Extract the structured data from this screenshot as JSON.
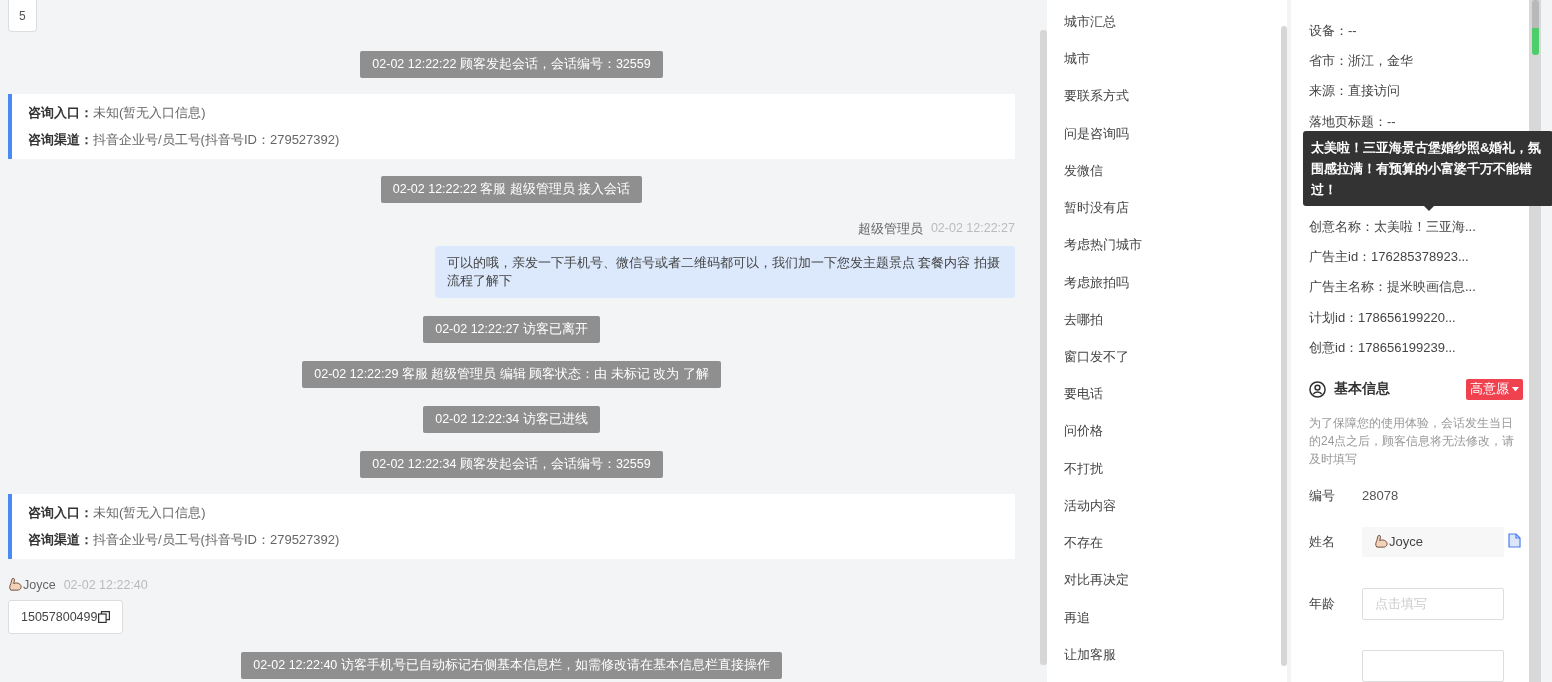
{
  "top_badge": "5",
  "chat": [
    {
      "kind": "notice",
      "text": "02-02 12:22:22 顾客发起会话，会话编号：32559"
    },
    {
      "kind": "source",
      "entry_label": "咨询入口：",
      "entry_value": "未知(暂无入口信息)",
      "channel_label": "咨询渠道：",
      "channel_value": "抖音企业号/员工号(抖音号ID：279527392)"
    },
    {
      "kind": "notice",
      "text": "02-02 12:22:22 客服 超级管理员 接入会话"
    },
    {
      "kind": "agent",
      "sender": "超级管理员",
      "time": "02-02 12:22:27",
      "text": "可以的哦，亲发一下手机号、微信号或者二维码都可以，我们加一下您发主题景点 套餐内容 拍摄流程了解下"
    },
    {
      "kind": "notice",
      "text": "02-02 12:22:27 访客已离开"
    },
    {
      "kind": "notice",
      "text": "02-02 12:22:29 客服 超级管理员 编辑 顾客状态：由 未标记 改为 了解"
    },
    {
      "kind": "notice",
      "text": "02-02 12:22:34 访客已进线"
    },
    {
      "kind": "notice",
      "text": "02-02 12:22:34 顾客发起会话，会话编号：32559"
    },
    {
      "kind": "source",
      "entry_label": "咨询入口：",
      "entry_value": "未知(暂无入口信息)",
      "channel_label": "咨询渠道：",
      "channel_value": "抖音企业号/员工号(抖音号ID：279527392)"
    },
    {
      "kind": "visitor",
      "sender": "Joyce",
      "time": "02-02 12:22:40",
      "text": "15057800499"
    },
    {
      "kind": "notice",
      "text": "02-02 12:22:40 访客手机号已自动标记右侧基本信息栏，如需修改请在基本信息栏直接操作"
    }
  ],
  "quick_replies": [
    "城市汇总",
    "城市",
    "要联系方式",
    "问是咨询吗",
    "发微信",
    "暂时没有店",
    "考虑热门城市",
    "考虑旅拍吗",
    "去哪拍",
    "窗口发不了",
    "要电话",
    "问价格",
    "不打扰",
    "活动内容",
    "不存在",
    "对比再决定",
    "再追",
    "让加客服"
  ],
  "visitor_info": {
    "rows_above": [
      "设备：--",
      "省市：浙江，金华",
      "来源：直接访问",
      "落地页标题：--"
    ],
    "tooltip": "太美啦！三亚海景古堡婚纱照&婚礼，氛围感拉满！有预算的小富婆千万不能错过！",
    "rows_below": [
      "创意名称：太美啦！三亚海...",
      "广告主id：176285378923...",
      "广告主名称：提米映画信息...",
      "计划id：178656199220...",
      "创意id：178656199239..."
    ]
  },
  "basic_info": {
    "title": "基本信息",
    "intent_tag": "高意愿",
    "note": "为了保障您的使用体验，会话发生当日的24点之后，顾客信息将无法修改，请及时填写",
    "fields": [
      {
        "kind": "text",
        "label": "编号",
        "value": "28078"
      },
      {
        "kind": "name",
        "label": "姓名",
        "value": "Joyce"
      },
      {
        "kind": "input",
        "label": "年龄",
        "placeholder": "点击填写"
      },
      {
        "kind": "input"
      }
    ]
  }
}
